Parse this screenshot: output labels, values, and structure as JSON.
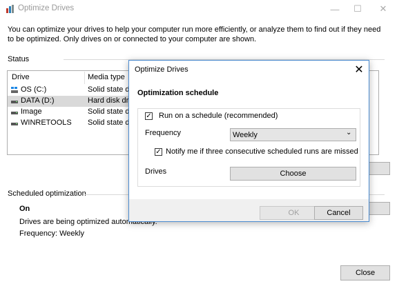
{
  "window": {
    "title": "Optimize Drives",
    "intro": "You can optimize your drives to help your computer run more efficiently, or analyze them to find out if they need to be optimized. Only drives on or connected to your computer are shown.",
    "close_button": "Close"
  },
  "status": {
    "label": "Status",
    "columns": [
      "Drive",
      "Media type"
    ],
    "drives": [
      {
        "name": "OS (C:)",
        "media": "Solid state dri",
        "icon": "windows-drive-icon"
      },
      {
        "name": "DATA (D:)",
        "media": "Hard disk drive",
        "icon": "hard-drive-icon"
      },
      {
        "name": "Image",
        "media": "Solid state dri",
        "icon": "hard-drive-icon"
      },
      {
        "name": "WINRETOOLS",
        "media": "Solid state dri",
        "icon": "hard-drive-icon"
      }
    ]
  },
  "scheduled": {
    "label": "Scheduled optimization",
    "state": "On",
    "description": "Drives are being optimized automatically.",
    "frequency": "Frequency: Weekly"
  },
  "dialog": {
    "title": "Optimize Drives",
    "heading": "Optimization schedule",
    "run_on_schedule": "Run on a schedule (recommended)",
    "run_checked": true,
    "frequency_label": "Frequency",
    "frequency_value": "Weekly",
    "notify_label": "Notify me if three consecutive scheduled runs are missed",
    "notify_checked": true,
    "drives_label": "Drives",
    "choose_button": "Choose",
    "ok_button": "OK",
    "cancel_button": "Cancel"
  },
  "colors": {
    "accent": "#4a8bd1",
    "selection": "#d9d9d9"
  }
}
